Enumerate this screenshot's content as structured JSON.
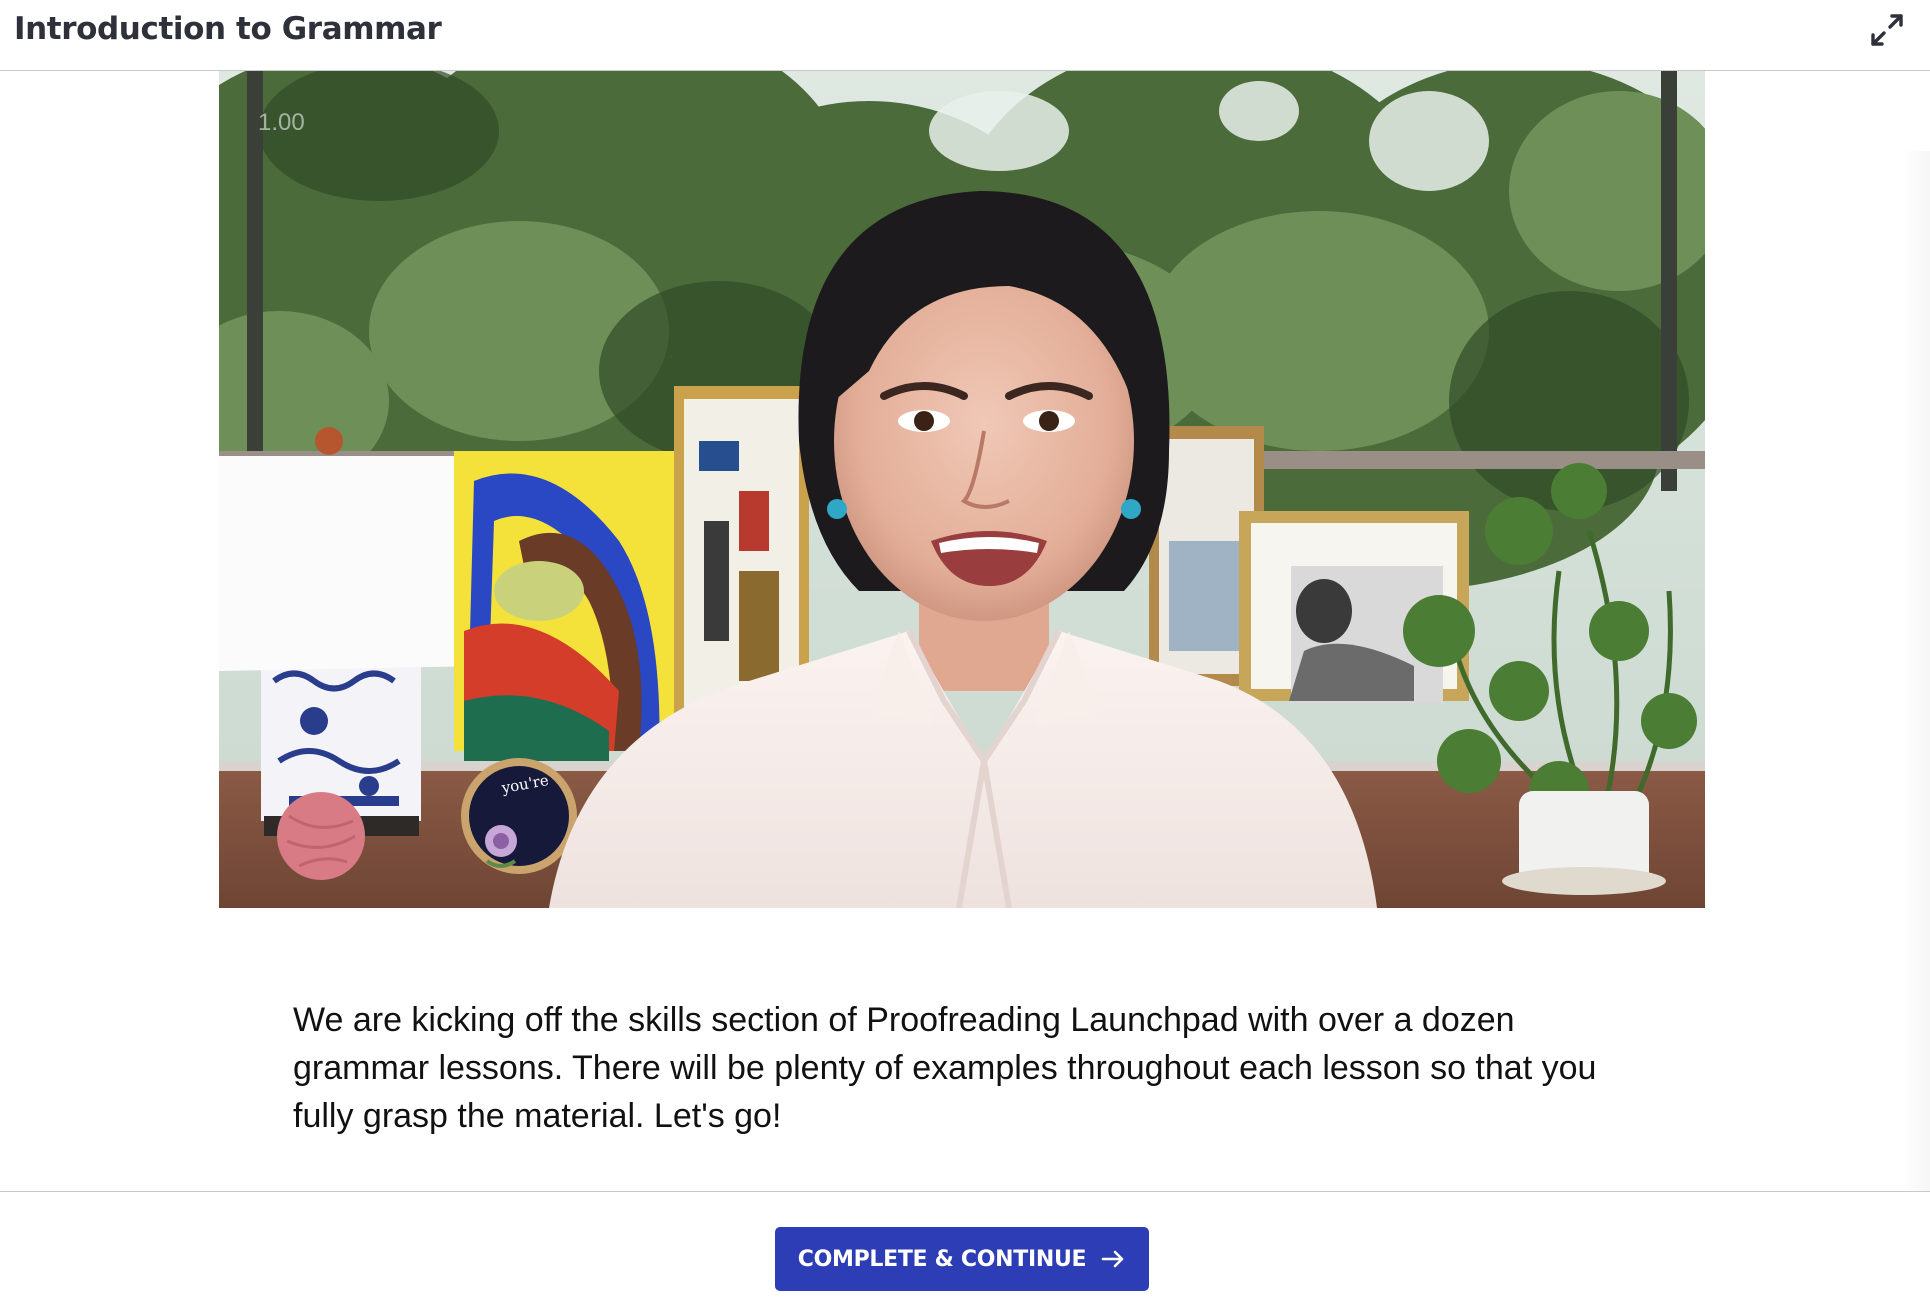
{
  "header": {
    "title": "Introduction to Grammar",
    "expand_icon": "expand-arrows-icon"
  },
  "video": {
    "playback_speed": "1.00",
    "embroidery_text": "you're"
  },
  "description": {
    "text": "We are kicking off the skills section of Proofreading Launchpad with over a dozen grammar lessons. There will be plenty of examples throughout each lesson so that you fully grasp the material. Let's go!"
  },
  "footer": {
    "button_label": "COMPLETE & CONTINUE",
    "button_icon": "arrow-right-icon"
  },
  "colors": {
    "accent": "#2d3db5",
    "title_text": "#2e3139",
    "divider": "#c9c9cc"
  }
}
